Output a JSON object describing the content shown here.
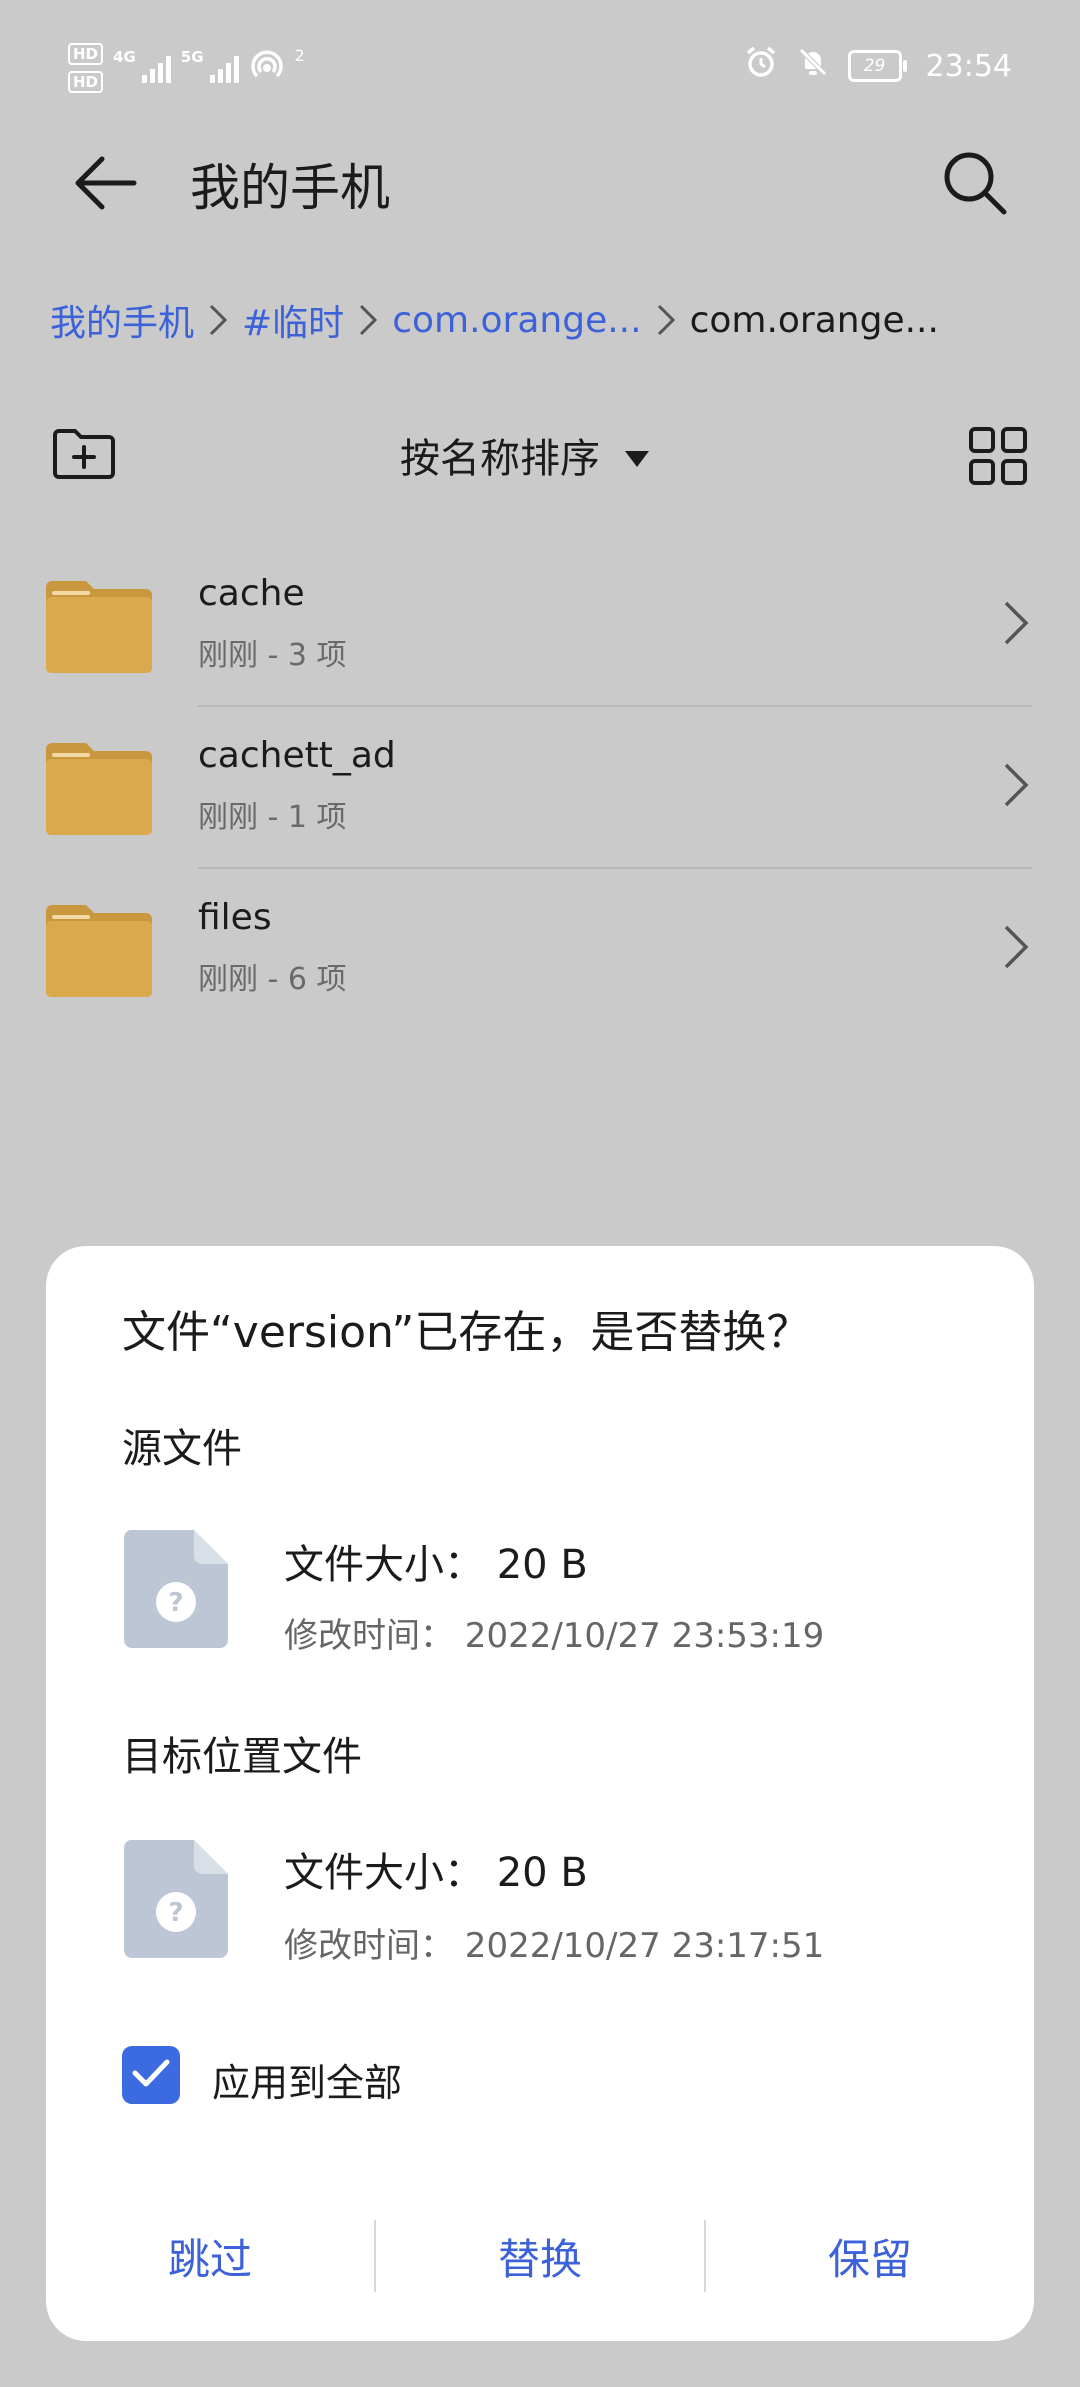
{
  "status_bar": {
    "hd_top": "HD",
    "hd_bottom": "HD",
    "net_4g": "4G",
    "net_5g": "5G",
    "hotspot_count": "2",
    "battery": "29",
    "time": "23:54"
  },
  "header": {
    "title": "我的手机",
    "back_icon": "arrow-left-icon",
    "search_icon": "search-icon"
  },
  "breadcrumb": {
    "items": [
      "我的手机",
      "#临时",
      "com.orange...",
      "com.orange..."
    ]
  },
  "toolbar": {
    "sort_label": "按名称排序",
    "new_folder_icon": "new-folder-icon",
    "grid_icon": "grid-view-icon"
  },
  "folders": [
    {
      "name": "cache",
      "meta": "刚刚 - 3 项"
    },
    {
      "name": "cachett_ad",
      "meta": "刚刚 - 1 项"
    },
    {
      "name": "files",
      "meta": "刚刚 - 6 项"
    }
  ],
  "dialog": {
    "title": "文件“version”已存在，是否替换？",
    "source": {
      "label": "源文件",
      "size": "文件大小：  20 B",
      "modified": "修改时间：  2022/10/27 23:53:19"
    },
    "target": {
      "label": "目标位置文件",
      "size": "文件大小：  20 B",
      "modified": "修改时间：  2022/10/27 23:17:51"
    },
    "apply_all": "应用到全部",
    "apply_all_checked": true,
    "buttons": {
      "skip": "跳过",
      "replace": "替换",
      "keep": "保留"
    }
  },
  "colors": {
    "background": "#cacaca",
    "accent": "#3c61d8",
    "folder": "#d9a94b"
  }
}
